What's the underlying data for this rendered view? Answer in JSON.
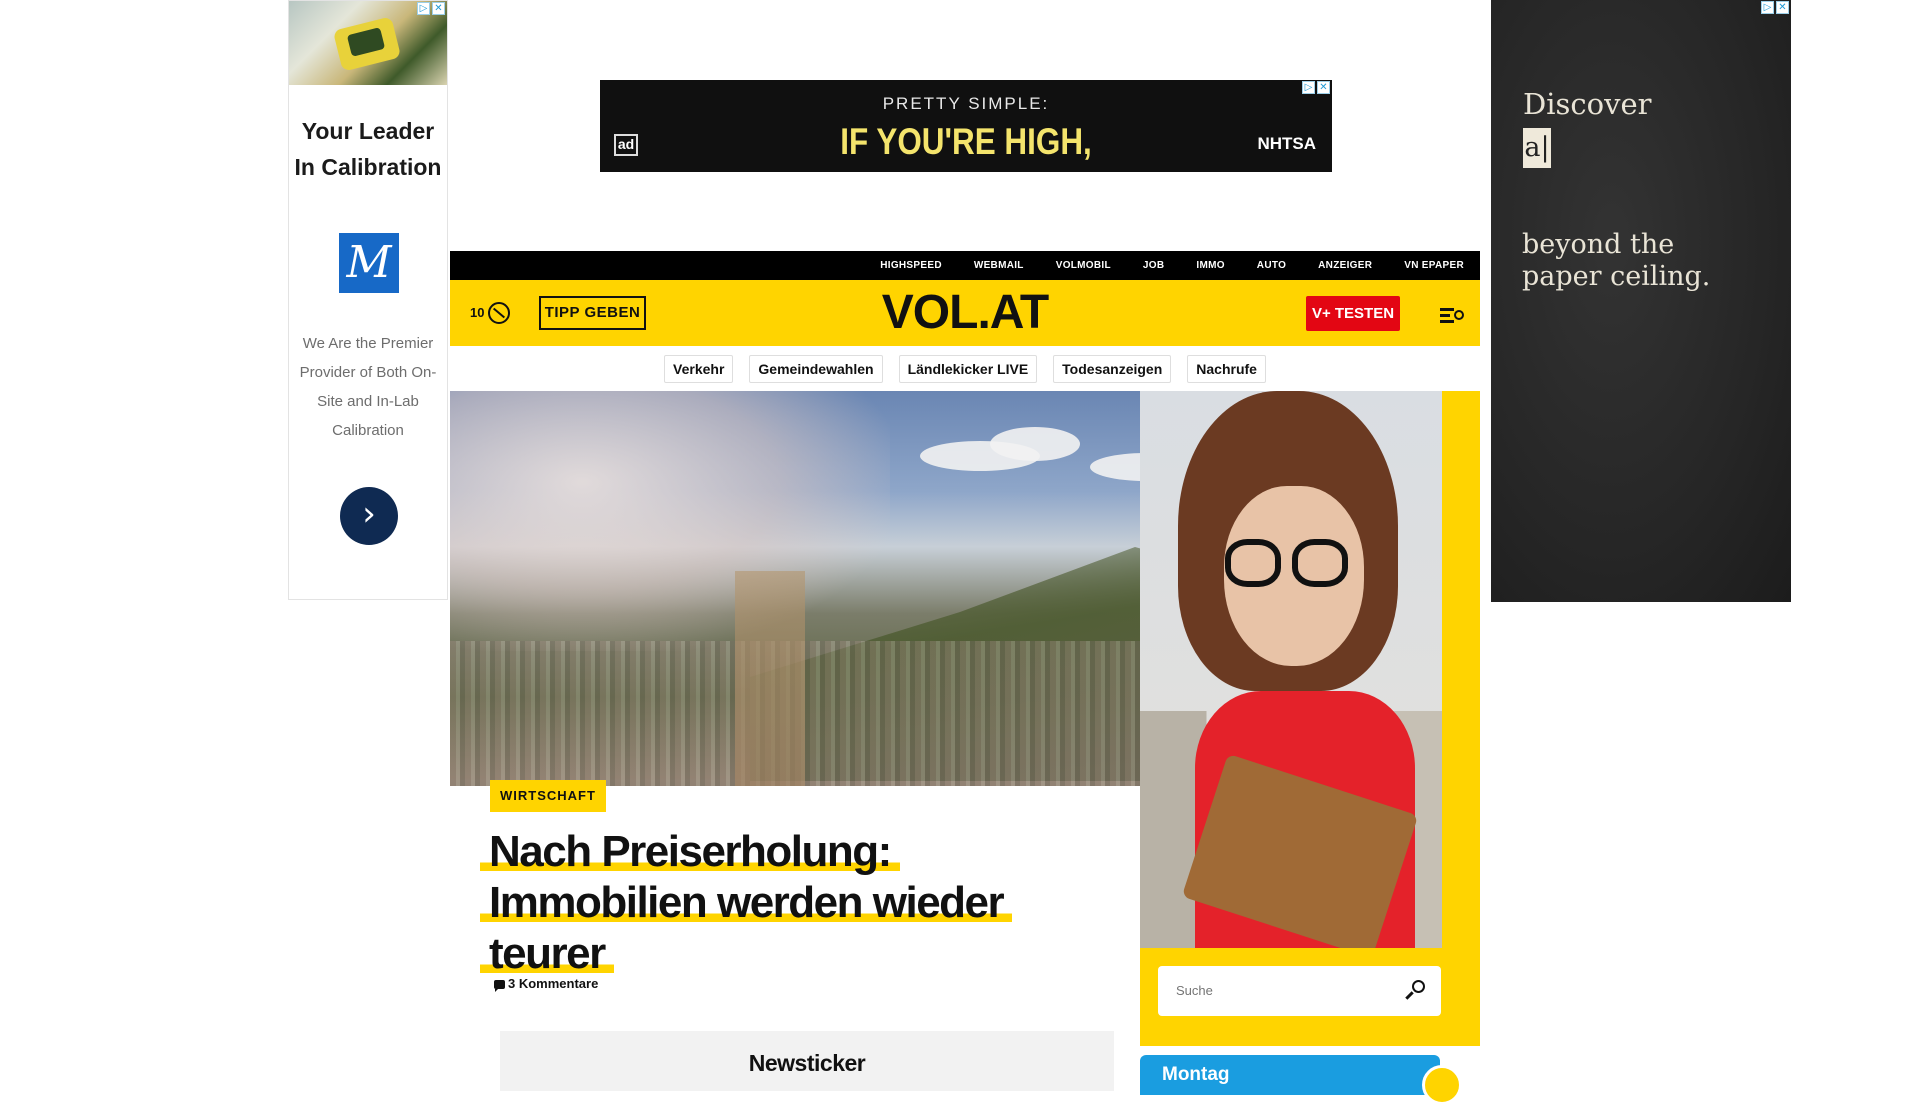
{
  "ads": {
    "left": {
      "headline": "Your Leader In Calibration",
      "logo_letter": "M",
      "body": "We Are the Premier Provider of Both On-Site and In-Lab Calibration",
      "next_symbol": "›",
      "adchoice": [
        "▷",
        "✕"
      ]
    },
    "top": {
      "line1": "PRETTY SIMPLE:",
      "line2": "IF YOU'RE HIGH,",
      "ad_logo": "ad",
      "brand": "NHTSA",
      "adchoice": [
        "▷",
        "✕"
      ]
    },
    "right": {
      "line1": "Discover",
      "cursor_text": "a|",
      "line2": "beyond the paper ceiling.",
      "adchoice": [
        "▷",
        "✕"
      ]
    }
  },
  "topnav": [
    "HIGHSPEED",
    "WEBMAIL",
    "VOLMOBIL",
    "JOB",
    "IMMO",
    "AUTO",
    "ANZEIGER",
    "VN EPAPER"
  ],
  "header": {
    "temperature": "10",
    "tipp_label": "TIPP GEBEN",
    "logo": "VOL.AT",
    "vplus_label": "V+ TESTEN"
  },
  "chips": [
    "Verkehr",
    "Gemeindewahlen",
    "Ländlekicker LIVE",
    "Todesanzeigen",
    "Nachrufe"
  ],
  "article": {
    "category": "WIRTSCHAFT",
    "title": "Nach Preiserholung: Immobilien werden wieder teurer",
    "comments": "3 Kommentare"
  },
  "search": {
    "placeholder": "Suche"
  },
  "newsticker": {
    "label": "Newsticker"
  },
  "weather_widget": {
    "day": "Montag"
  },
  "colors": {
    "brand_yellow": "#ffd400",
    "vplus_red": "#e30613",
    "nav_black": "#000000",
    "widget_blue": "#1a9de0"
  }
}
